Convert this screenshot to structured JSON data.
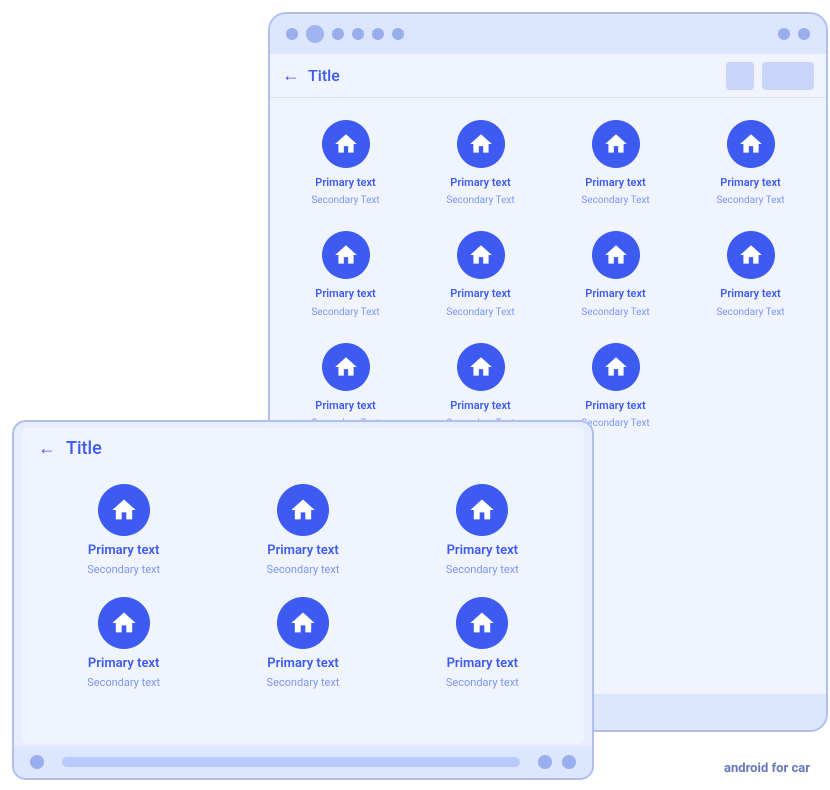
{
  "phone": {
    "title": "Title",
    "statusDots": [
      "dot",
      "dot",
      "dot",
      "dot",
      "dot",
      "dot",
      "dot"
    ],
    "appBarIcons": [
      "square-icon",
      "rect-icon"
    ],
    "rows": [
      {
        "items": [
          {
            "primary": "Primary text",
            "secondary": "Secondary Text"
          },
          {
            "primary": "Primary text",
            "secondary": "Secondary Text"
          },
          {
            "primary": "Primary text",
            "secondary": "Secondary Text"
          },
          {
            "primary": "Primary text",
            "secondary": "Secondary Text"
          }
        ]
      },
      {
        "items": [
          {
            "primary": "Primary text",
            "secondary": "Secondary Text"
          },
          {
            "primary": "Primary text",
            "secondary": "Secondary Text"
          },
          {
            "primary": "Primary text",
            "secondary": "Secondary Text"
          },
          {
            "primary": "Primary text",
            "secondary": "Secondary Text"
          }
        ]
      },
      {
        "items": [
          {
            "primary": "Primary text",
            "secondary": "Secondary Text"
          },
          {
            "primary": "Primary text",
            "secondary": "Secondary Text"
          },
          {
            "primary": "Primary text",
            "secondary": "Secondary Text"
          }
        ]
      }
    ]
  },
  "tablet": {
    "title": "Title",
    "rows": [
      {
        "items": [
          {
            "primary": "Primary text",
            "secondary": "Secondary text"
          },
          {
            "primary": "Primary text",
            "secondary": "Secondary text"
          },
          {
            "primary": "Primary text",
            "secondary": "Secondary text"
          }
        ]
      },
      {
        "items": [
          {
            "primary": "Primary text",
            "secondary": "Secondary text"
          },
          {
            "primary": "Primary text",
            "secondary": "Secondary text"
          },
          {
            "primary": "Primary text",
            "secondary": "Secondary text"
          }
        ]
      }
    ]
  },
  "footer": {
    "label": "android",
    "suffix": " for car"
  }
}
